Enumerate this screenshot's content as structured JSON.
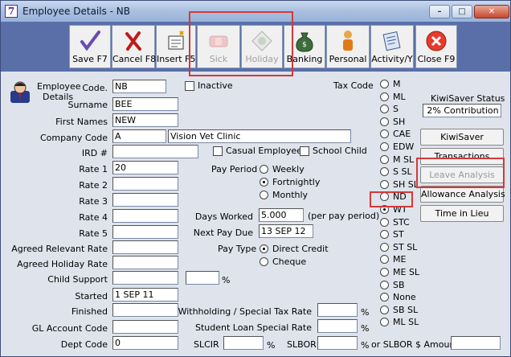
{
  "window": {
    "title": "Employee Details - NB",
    "app_icon": "7"
  },
  "toolbar": {
    "save": "Save F7",
    "cancel": "Cancel F8",
    "insert": "Insert F5",
    "sick": "Sick",
    "holiday": "Holiday",
    "banking": "Banking",
    "personal": "Personal",
    "activity": "Activity/Y",
    "close": "Close F9"
  },
  "employee": {
    "header_line1": "Employee",
    "header_line2": "Details",
    "code_label": "Code.",
    "code": "NB",
    "inactive_label": "Inactive",
    "surname_label": "Surname",
    "surname": "BEE",
    "first_names_label": "First Names",
    "first_names": "NEW",
    "company_code_label": "Company Code",
    "company_code": "A",
    "company_name": "Vision Vet Clinic",
    "ird_label": "IRD #",
    "ird": "",
    "casual_label": "Casual Employee",
    "school_child_label": "School Child",
    "rate1_label": "Rate 1",
    "rate1": "20",
    "rate2_label": "Rate 2",
    "rate3_label": "Rate 3",
    "rate4_label": "Rate 4",
    "rate5_label": "Rate 5",
    "agreed_relevant_label": "Agreed Relevant Rate",
    "agreed_holiday_label": "Agreed Holiday Rate",
    "child_support_label": "Child Support",
    "percent": "%",
    "started_label": "Started",
    "started": "1 SEP 11",
    "finished_label": "Finished",
    "gl_label": "GL Account Code",
    "dept_label": "Dept Code",
    "dept": "0"
  },
  "pay": {
    "period_label": "Pay Period",
    "weekly": "Weekly",
    "fortnightly": "Fortnightly",
    "monthly": "Monthly",
    "days_worked_label": "Days Worked",
    "days_worked": "5.000",
    "per_period": "(per pay period)",
    "next_pay_due_label": "Next Pay Due",
    "next_pay_due": "13 SEP 12",
    "pay_type_label": "Pay Type",
    "direct_credit": "Direct Credit",
    "cheque": "Cheque",
    "withholding_label": "Withholding / Special Tax Rate",
    "student_loan_label": "Student Loan Special Rate",
    "slcir_label": "SLCIR",
    "slbor_label": "SLBOR",
    "slbor_amount_label": "or SLBOR $ Amount"
  },
  "tax": {
    "label": "Tax Code",
    "codes": [
      "M",
      "ML",
      "S",
      "SH",
      "CAE",
      "EDW",
      "M SL",
      "S SL",
      "SH SL",
      "ND",
      "WT",
      "STC",
      "ST",
      "ST SL",
      "ME",
      "ME SL",
      "SB",
      "None",
      "SB SL",
      "ML SL"
    ],
    "selected": "WT"
  },
  "kiwisaver": {
    "status_label": "KiwiSaver Status",
    "status": "2% Contribution"
  },
  "buttons": {
    "kiwisaver": "KiwiSaver",
    "transactions": "Transactions",
    "leave_analysis": "Leave Analysis",
    "allowance_analysis": "Allowance Analysis",
    "time_in_lieu": "Time in Lieu"
  }
}
